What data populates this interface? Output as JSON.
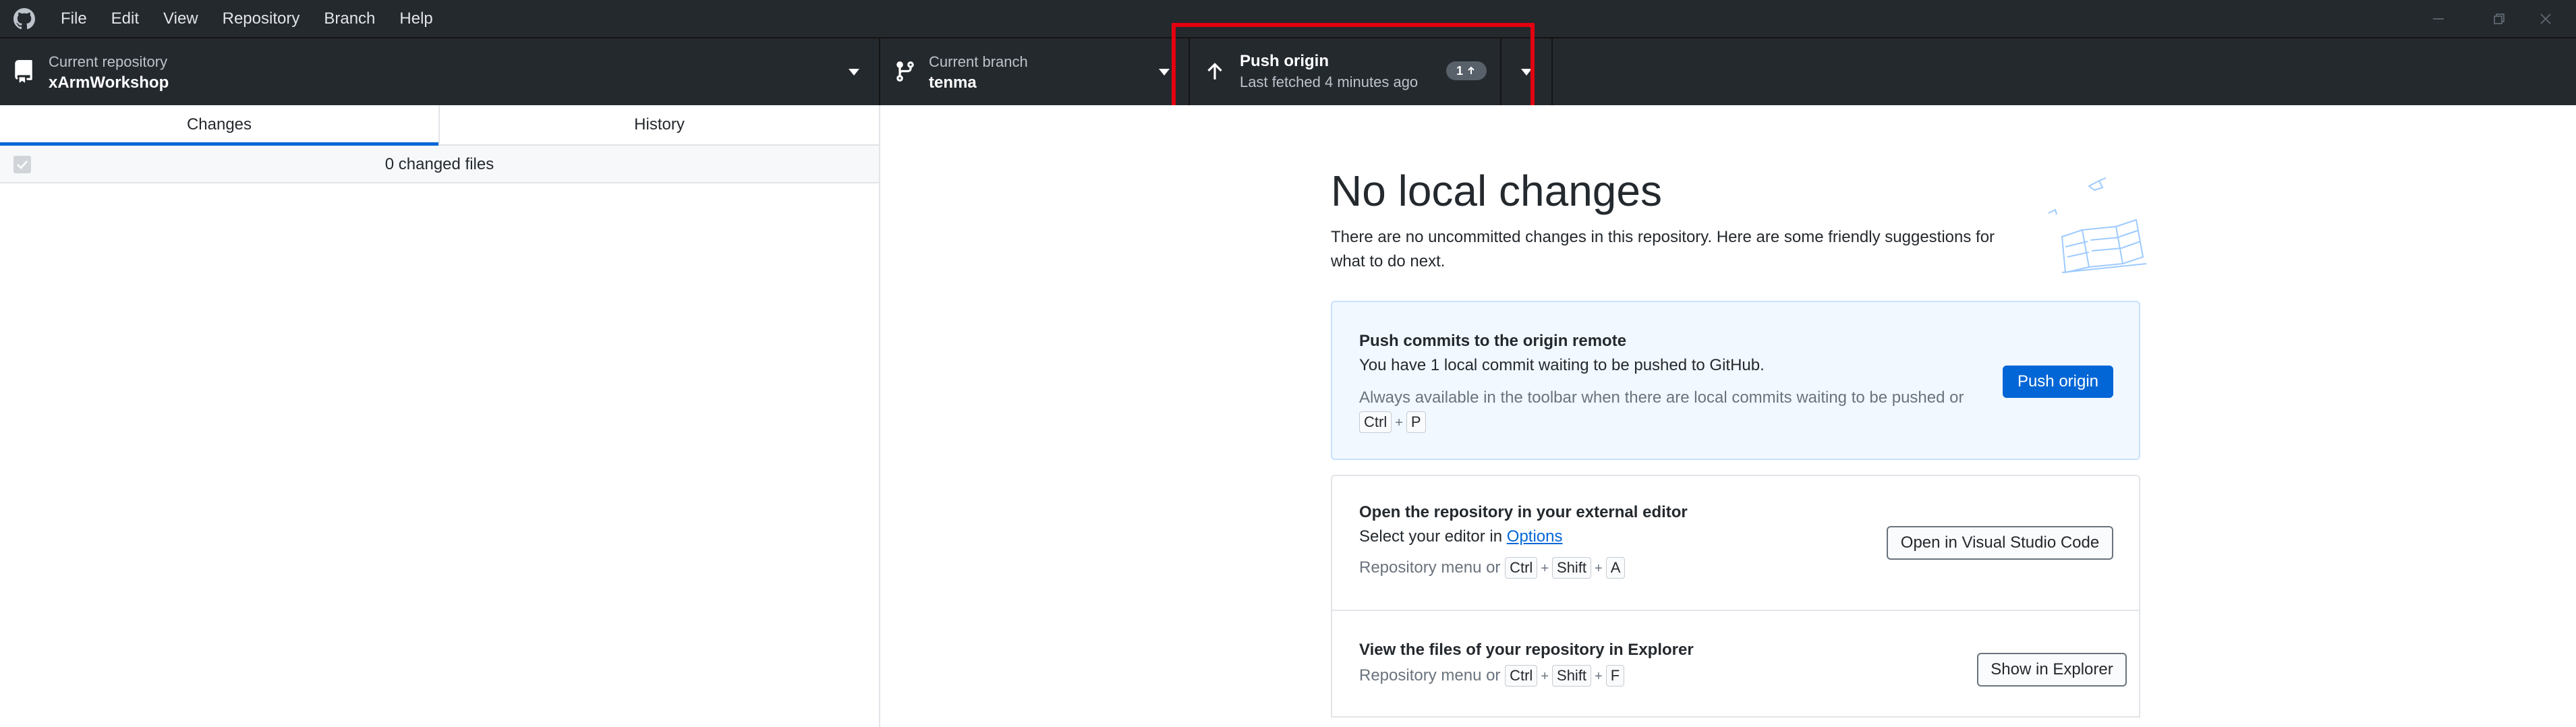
{
  "menu": [
    "File",
    "Edit",
    "View",
    "Repository",
    "Branch",
    "Help"
  ],
  "toolbar": {
    "repo_label": "Current repository",
    "repo_value": "xArmWorkshop",
    "branch_label": "Current branch",
    "branch_value": "tenma",
    "push_title": "Push origin",
    "push_sub": "Last fetched 4 minutes ago",
    "push_badge": "1"
  },
  "sidebar": {
    "tabs": [
      "Changes",
      "History"
    ],
    "changed_files": "0 changed files"
  },
  "main": {
    "heading": "No local changes",
    "intro": "There are no uncommitted changes in this repository. Here are some friendly suggestions for what to do next.",
    "push_card": {
      "title": "Push commits to the origin remote",
      "text": "You have 1 local commit waiting to be pushed to GitHub.",
      "sub": "Always available in the toolbar when there are local commits waiting to be pushed or",
      "keys": [
        "Ctrl",
        "P"
      ],
      "button": "Push origin"
    },
    "editor_card": {
      "title": "Open the repository in your external editor",
      "text_prefix": "Select your editor in",
      "link": "Options",
      "sub_prefix": "Repository menu or",
      "keys": [
        "Ctrl",
        "Shift",
        "A"
      ],
      "button": "Open in Visual Studio Code"
    },
    "explorer_card": {
      "title": "View the files of your repository in Explorer",
      "sub_prefix": "Repository menu or",
      "keys": [
        "Ctrl",
        "Shift",
        "F"
      ],
      "button": "Show in Explorer"
    }
  },
  "colors": {
    "toolbar_bg": "#24292e",
    "accent": "#0366d6",
    "highlight": "#e3000f"
  },
  "icons": [
    "github-logo-icon",
    "repo-icon",
    "branch-icon",
    "arrow-up-icon",
    "caret-down-icon",
    "minimize-icon",
    "maximize-icon",
    "close-icon"
  ]
}
